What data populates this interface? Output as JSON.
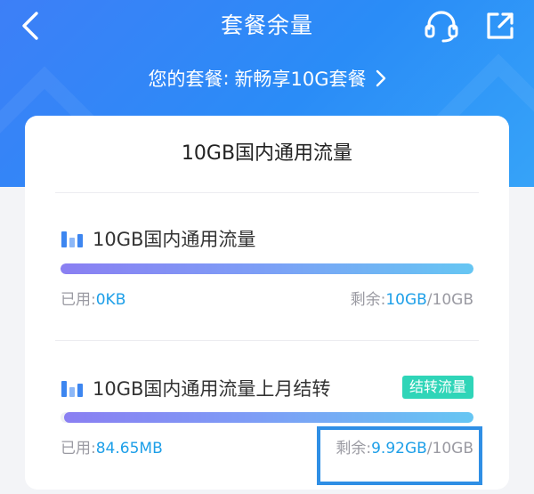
{
  "header": {
    "title": "套餐余量",
    "plan_prefix": "您的套餐",
    "plan_sep": ":",
    "plan_name": "新畅享10G套餐"
  },
  "card": {
    "heading": "10GB国内通用流量",
    "sections": [
      {
        "title": "10GB国内通用流量",
        "badge": "",
        "used_label": "已用:",
        "used_value": "0KB",
        "remain_label": "剩余:",
        "remain_value": "10GB",
        "total": "/10GB",
        "remaining_fraction": 1.0
      },
      {
        "title": "10GB国内通用流量上月结转",
        "badge": "结转流量",
        "used_label": "已用:",
        "used_value": "84.65MB",
        "remain_label": "剩余:",
        "remain_value": "9.92GB",
        "total": "/10GB",
        "remaining_fraction": 0.992
      }
    ]
  },
  "colors": {
    "header_gradient_start": "#3d7ff7",
    "header_gradient_end": "#36a3f8",
    "accent_value": "#1d9fe8",
    "badge": "#2fd5b8",
    "highlight_box": "#2f8fe5"
  },
  "icons": [
    "back-chevron-icon",
    "headset-icon",
    "share-out-icon",
    "chevron-right-icon",
    "bar-chart-icon"
  ]
}
